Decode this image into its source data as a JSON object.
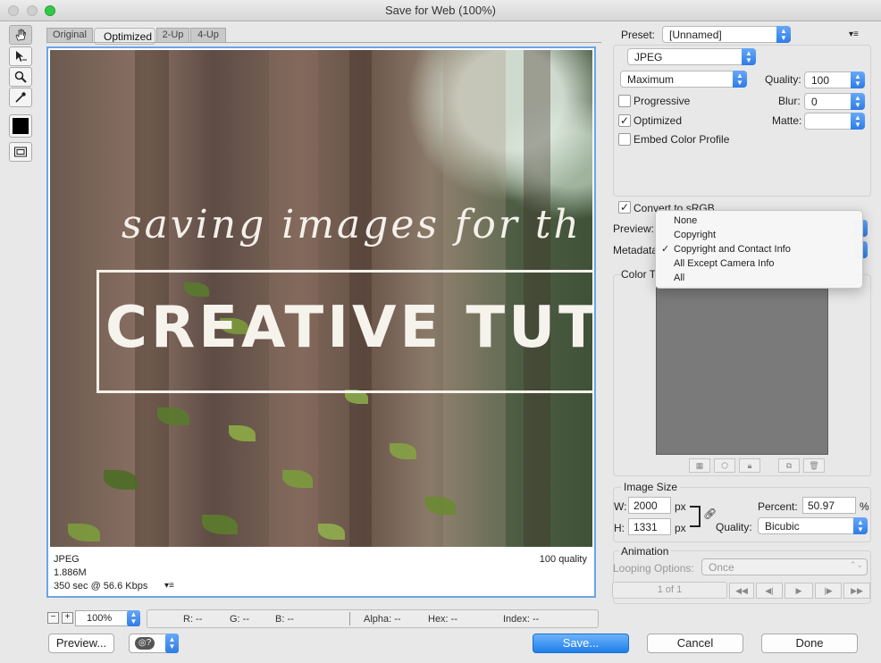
{
  "window": {
    "title": "Save for Web (100%)"
  },
  "tools": [
    "hand-tool",
    "slice-select-tool",
    "zoom-tool",
    "eyedropper-tool",
    "eyedropper-color",
    "toggle-slices-visibility"
  ],
  "tabs": [
    {
      "label": "Original"
    },
    {
      "label": "Optimized"
    },
    {
      "label": "2-Up"
    },
    {
      "label": "4-Up"
    }
  ],
  "preview": {
    "script_text": "saving images for th",
    "title_text": "CREATIVE TUT",
    "info": {
      "format": "JPEG",
      "size": "1.886M",
      "download": "350 sec @ 56.6 Kbps",
      "quality": "100 quality"
    }
  },
  "status": {
    "zoom": "100%",
    "r_label": "R: --",
    "g_label": "G: --",
    "b_label": "B: --",
    "alpha_label": "Alpha: --",
    "hex_label": "Hex: --",
    "index_label": "Index: --"
  },
  "buttons": {
    "preview": "Preview...",
    "save": "Save...",
    "cancel": "Cancel",
    "done": "Done"
  },
  "settings": {
    "preset_label": "Preset:",
    "preset_value": "[Unnamed]",
    "format": "JPEG",
    "compression": "Maximum",
    "quality_label": "Quality:",
    "quality_value": "100",
    "blur_label": "Blur:",
    "blur_value": "0",
    "matte_label": "Matte:",
    "progressive_label": "Progressive",
    "progressive_checked": false,
    "optimized_label": "Optimized",
    "optimized_checked": true,
    "embed_label": "Embed Color Profile",
    "embed_checked": false,
    "convert_label": "Convert to sRGB",
    "convert_checked": true,
    "preview_label": "Preview:",
    "metadata_label": "Metadata",
    "color_table_label": "Color T"
  },
  "metadata_menu": {
    "items": [
      "None",
      "Copyright",
      "Copyright and Contact Info",
      "All Except Camera Info",
      "All"
    ],
    "selected": "Copyright and Contact Info"
  },
  "image_size": {
    "heading": "Image Size",
    "w_label": "W:",
    "w_value": "2000",
    "h_label": "H:",
    "h_value": "1331",
    "unit": "px",
    "percent_label": "Percent:",
    "percent_value": "50.97",
    "percent_unit": "%",
    "quality_label": "Quality:",
    "quality_value": "Bicubic"
  },
  "animation": {
    "heading": "Animation",
    "looping_label": "Looping Options:",
    "looping_value": "Once",
    "frame_counter": "1 of 1"
  },
  "colors": {
    "accent": "#2e7ce8",
    "selection_border": "#6aa5e8"
  }
}
